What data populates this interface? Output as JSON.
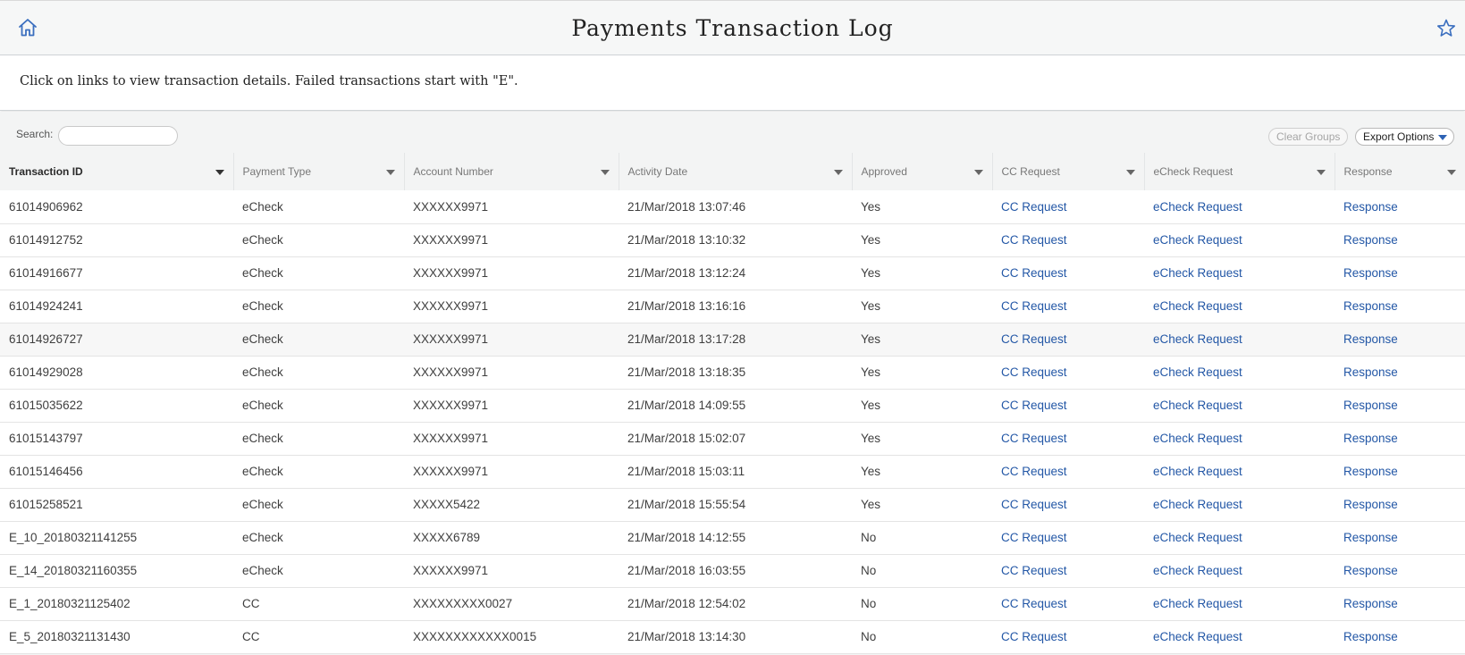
{
  "header": {
    "title": "Payments Transaction Log",
    "home_icon": "home-icon",
    "favorite_icon": "star-icon"
  },
  "info": {
    "text": "Click on links to view transaction details. Failed transactions start with \"E\"."
  },
  "toolbar": {
    "search_label": "Search:",
    "search_value": "",
    "clear_groups_label": "Clear Groups",
    "export_options_label": "Export Options"
  },
  "table": {
    "columns": [
      {
        "label": "Transaction ID",
        "sorted": true
      },
      {
        "label": "Payment Type",
        "sorted": false
      },
      {
        "label": "Account Number",
        "sorted": false
      },
      {
        "label": "Activity Date",
        "sorted": false
      },
      {
        "label": "Approved",
        "sorted": false
      },
      {
        "label": "CC Request",
        "sorted": false
      },
      {
        "label": "eCheck Request",
        "sorted": false
      },
      {
        "label": "Response",
        "sorted": false
      }
    ],
    "rows": [
      {
        "id": "61014906962",
        "type": "eCheck",
        "account": "XXXXXX9971",
        "date": "21/Mar/2018 13:07:46",
        "approved": "Yes",
        "cc": "CC Request",
        "echeck": "eCheck Request",
        "response": "Response"
      },
      {
        "id": "61014912752",
        "type": "eCheck",
        "account": "XXXXXX9971",
        "date": "21/Mar/2018 13:10:32",
        "approved": "Yes",
        "cc": "CC Request",
        "echeck": "eCheck Request",
        "response": "Response"
      },
      {
        "id": "61014916677",
        "type": "eCheck",
        "account": "XXXXXX9971",
        "date": "21/Mar/2018 13:12:24",
        "approved": "Yes",
        "cc": "CC Request",
        "echeck": "eCheck Request",
        "response": "Response"
      },
      {
        "id": "61014924241",
        "type": "eCheck",
        "account": "XXXXXX9971",
        "date": "21/Mar/2018 13:16:16",
        "approved": "Yes",
        "cc": "CC Request",
        "echeck": "eCheck Request",
        "response": "Response"
      },
      {
        "id": "61014926727",
        "type": "eCheck",
        "account": "XXXXXX9971",
        "date": "21/Mar/2018 13:17:28",
        "approved": "Yes",
        "cc": "CC Request",
        "echeck": "eCheck Request",
        "response": "Response",
        "shaded": true
      },
      {
        "id": "61014929028",
        "type": "eCheck",
        "account": "XXXXXX9971",
        "date": "21/Mar/2018 13:18:35",
        "approved": "Yes",
        "cc": "CC Request",
        "echeck": "eCheck Request",
        "response": "Response"
      },
      {
        "id": "61015035622",
        "type": "eCheck",
        "account": "XXXXXX9971",
        "date": "21/Mar/2018 14:09:55",
        "approved": "Yes",
        "cc": "CC Request",
        "echeck": "eCheck Request",
        "response": "Response"
      },
      {
        "id": "61015143797",
        "type": "eCheck",
        "account": "XXXXXX9971",
        "date": "21/Mar/2018 15:02:07",
        "approved": "Yes",
        "cc": "CC Request",
        "echeck": "eCheck Request",
        "response": "Response"
      },
      {
        "id": "61015146456",
        "type": "eCheck",
        "account": "XXXXXX9971",
        "date": "21/Mar/2018 15:03:11",
        "approved": "Yes",
        "cc": "CC Request",
        "echeck": "eCheck Request",
        "response": "Response"
      },
      {
        "id": "61015258521",
        "type": "eCheck",
        "account": "XXXXX5422",
        "date": "21/Mar/2018 15:55:54",
        "approved": "Yes",
        "cc": "CC Request",
        "echeck": "eCheck Request",
        "response": "Response"
      },
      {
        "id": "E_10_20180321141255",
        "type": "eCheck",
        "account": "XXXXX6789",
        "date": "21/Mar/2018 14:12:55",
        "approved": "No",
        "cc": "CC Request",
        "echeck": "eCheck Request",
        "response": "Response"
      },
      {
        "id": "E_14_20180321160355",
        "type": "eCheck",
        "account": "XXXXXX9971",
        "date": "21/Mar/2018 16:03:55",
        "approved": "No",
        "cc": "CC Request",
        "echeck": "eCheck Request",
        "response": "Response"
      },
      {
        "id": "E_1_20180321125402",
        "type": "CC",
        "account": "XXXXXXXXX0027",
        "date": "21/Mar/2018 12:54:02",
        "approved": "No",
        "cc": "CC Request",
        "echeck": "eCheck Request",
        "response": "Response"
      },
      {
        "id": "E_5_20180321131430",
        "type": "CC",
        "account": "XXXXXXXXXXXX0015",
        "date": "21/Mar/2018 13:14:30",
        "approved": "No",
        "cc": "CC Request",
        "echeck": "eCheck Request",
        "response": "Response"
      }
    ]
  },
  "colors": {
    "link": "#2357a6",
    "header_bg": "#f6f7f7",
    "grid_bg": "#f3f4f4",
    "accent": "#2d62b4"
  }
}
